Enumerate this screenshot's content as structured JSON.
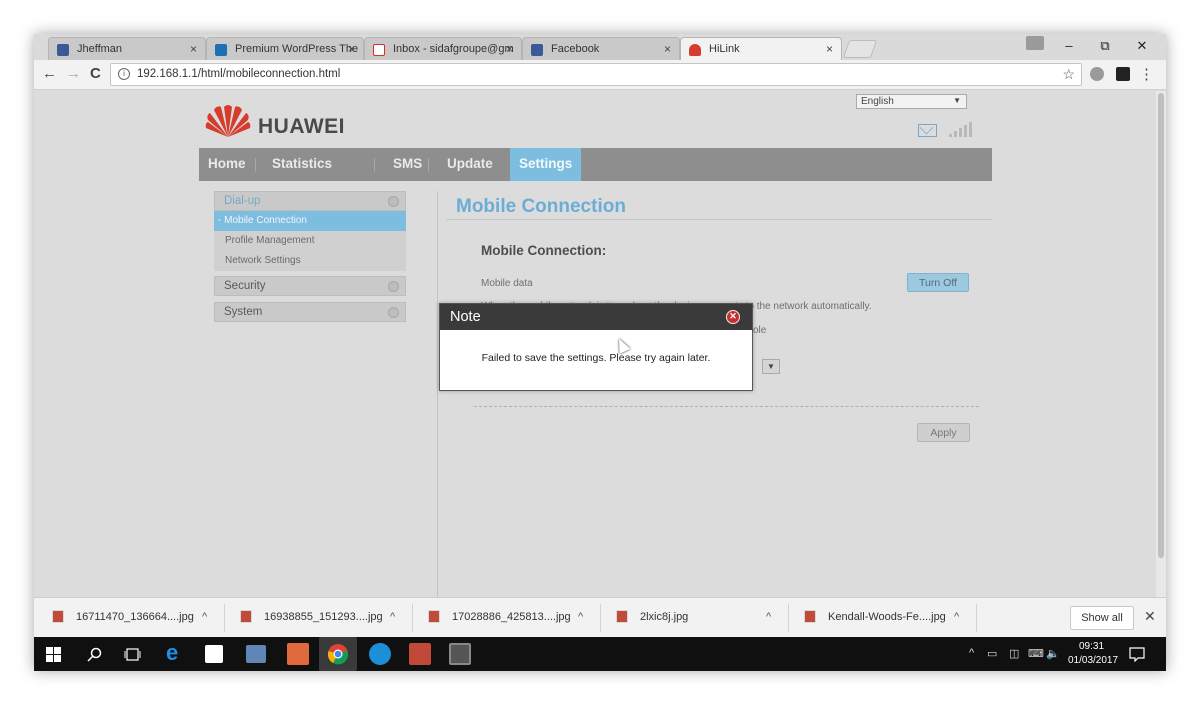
{
  "browser": {
    "tabs": [
      {
        "title": "Jheffman",
        "favicon_color": "#3b5998"
      },
      {
        "title": "Premium WordPress The",
        "favicon_color": "#1e6fb3"
      },
      {
        "title": "Inbox - sidafgroupe@gm",
        "favicon_color": "#d93025"
      },
      {
        "title": "Facebook",
        "favicon_color": "#3b5998"
      },
      {
        "title": "HiLink",
        "favicon_color": "#d63c2e"
      }
    ],
    "tab_close": "×",
    "window": {
      "minimize": "–",
      "maximize": "⧉",
      "close": "✕"
    },
    "nav": {
      "back": "←",
      "forward": "→",
      "reload": "C"
    },
    "url": "192.168.1.1/html/mobileconnection.html",
    "star": "☆",
    "menu": "⋮"
  },
  "page": {
    "language": "English",
    "brand": "HUAWEI",
    "accent_color": "#7dbde0",
    "nav": [
      "Home",
      "Statistics",
      "SMS",
      "Update",
      "Settings"
    ],
    "sidebar": {
      "dialup": "Dial-up",
      "sub": [
        "Mobile Connection",
        "Profile Management",
        "Network Settings"
      ],
      "security": "Security",
      "system": "System"
    },
    "title": "Mobile Connection",
    "section_title": "Mobile Connection:",
    "mobile_data_label": "Mobile data",
    "turn_off_label": "Turn Off",
    "description": "When the mobile network is turned on, the device connects to the network automatically.",
    "partial_text": "ole",
    "apply_label": "Apply"
  },
  "modal": {
    "title": "Note",
    "message": "Failed to save the settings. Please try again later.",
    "close_icon": "✕"
  },
  "downloads": {
    "items": [
      "16711470_136664....jpg",
      "16938855_151293....jpg",
      "17028886_425813....jpg",
      "2lxic8j.jpg",
      "Kendall-Woods-Fe....jpg"
    ],
    "chevron": "^",
    "show_all": "Show all",
    "close": "✕"
  },
  "taskbar": {
    "time": "09:31",
    "date": "01/03/2017"
  }
}
